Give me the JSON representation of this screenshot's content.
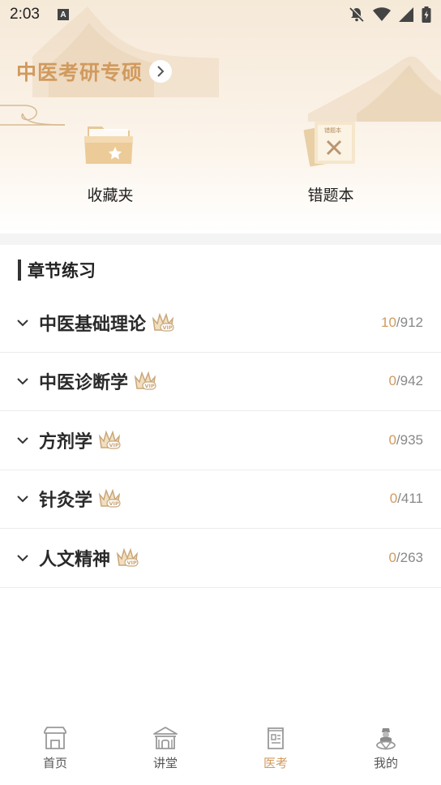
{
  "status_bar": {
    "time": "2:03",
    "notification_glyph": "A"
  },
  "header": {
    "title": "中医考研专硕"
  },
  "quick_entries": [
    {
      "label": "收藏夹",
      "icon": "folder-star-icon"
    },
    {
      "label": "错题本",
      "icon": "mistake-book-icon",
      "icon_text": "错题本"
    }
  ],
  "section": {
    "title": "章节练习"
  },
  "chapters": [
    {
      "name": "中医基础理论",
      "done": "10",
      "total": "/912",
      "vip": true
    },
    {
      "name": "中医诊断学",
      "done": "0",
      "total": "/942",
      "vip": true
    },
    {
      "name": "方剂学",
      "done": "0",
      "total": "/935",
      "vip": true
    },
    {
      "name": "针灸学",
      "done": "0",
      "total": "/411",
      "vip": true
    },
    {
      "name": "人文精神",
      "done": "0",
      "total": "/263",
      "vip": true
    }
  ],
  "bottom_nav": [
    {
      "label": "首页",
      "icon": "home-icon",
      "active": false
    },
    {
      "label": "讲堂",
      "icon": "lecture-hall-icon",
      "active": false
    },
    {
      "label": "医考",
      "icon": "exam-book-icon",
      "active": true
    },
    {
      "label": "我的",
      "icon": "profile-icon",
      "active": false
    }
  ],
  "colors": {
    "accent": "#d19a5e",
    "text": "#222222",
    "muted": "#888888"
  }
}
